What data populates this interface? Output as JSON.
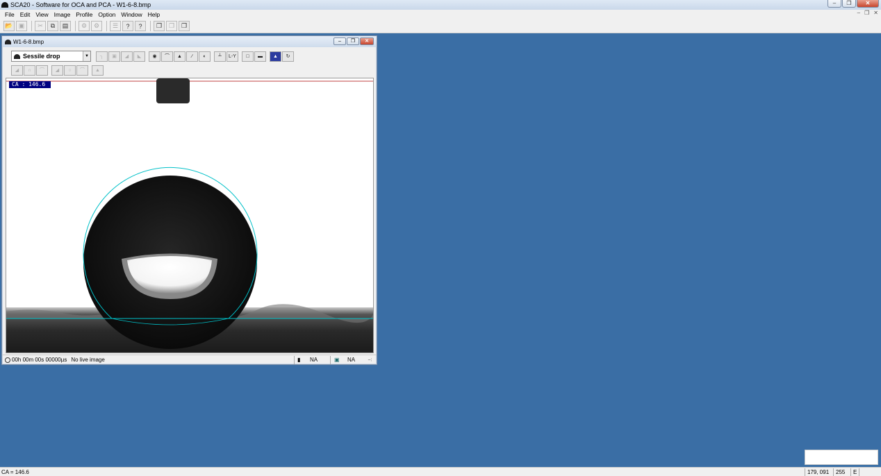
{
  "window": {
    "title": "SCA20 - Software for OCA and PCA - W1-6-8.bmp"
  },
  "menu": [
    "File",
    "Edit",
    "View",
    "Image",
    "Profile",
    "Option",
    "Window",
    "Help"
  ],
  "child": {
    "title": "W1-6-8.bmp",
    "mode_select": "Sessile drop",
    "ly_button": "L-Y",
    "ca_overlay": "CA :  146.6",
    "status": {
      "time": "00h 00m 00s 00000µs",
      "live": "No live image",
      "value1": "NA",
      "value2": "NA"
    }
  },
  "statusbar": {
    "ca": "CA = 146.6",
    "coords": "179, 091",
    "intensity": "255",
    "flag": "E"
  },
  "colors": {
    "desktop": "#3a6ea5",
    "fit_line": "#00c0c8",
    "needle_line": "#c04040"
  }
}
